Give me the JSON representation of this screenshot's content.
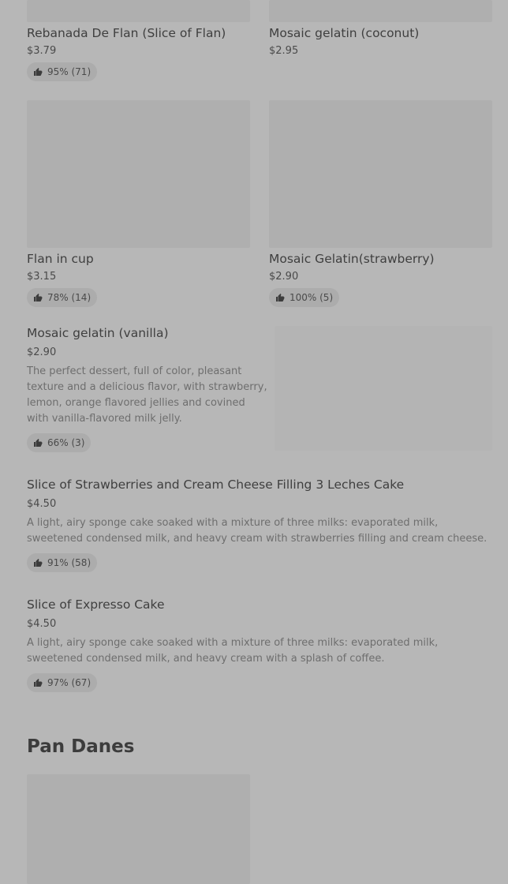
{
  "items": {
    "flan_slice": {
      "name": "Rebanada De Flan (Slice of Flan)",
      "price": "$3.79",
      "rating": "95% (71)"
    },
    "coconut": {
      "name": "Mosaic gelatin (coconut)",
      "price": "$2.95"
    },
    "flan_cup": {
      "name": "Flan in cup",
      "price": "$3.15",
      "rating": "78% (14)"
    },
    "strawberry": {
      "name": "Mosaic Gelatin(strawberry)",
      "price": "$2.90",
      "rating": "100% (5)"
    },
    "vanilla": {
      "name": "Mosaic gelatin (vanilla)",
      "price": "$2.90",
      "description": "The perfect dessert, full of color, pleasant texture and a delicious flavor, with strawberry, lemon, orange flavored jellies and covined with vanilla-flavored milk jelly.",
      "rating": "66% (3)"
    },
    "tres_leches": {
      "name": "Slice of Strawberries and Cream Cheese Filling 3 Leches Cake",
      "price": "$4.50",
      "description": "A light, airy sponge cake soaked with a mixture of three milks: evaporated milk, sweetened condensed milk, and heavy cream with strawberries filling and cream cheese.",
      "rating": "91% (58)"
    },
    "expresso": {
      "name": "Slice of Expresso Cake",
      "price": "$4.50",
      "description": "A light, airy sponge cake soaked with a mixture of three milks: evaporated milk, sweetened condensed milk, and heavy cream with a splash of coffee.",
      "rating": "97% (67)"
    }
  },
  "sections": {
    "pan_danes": "Pan Danes"
  },
  "icons": {
    "rating": "thumbs-up-icon"
  }
}
